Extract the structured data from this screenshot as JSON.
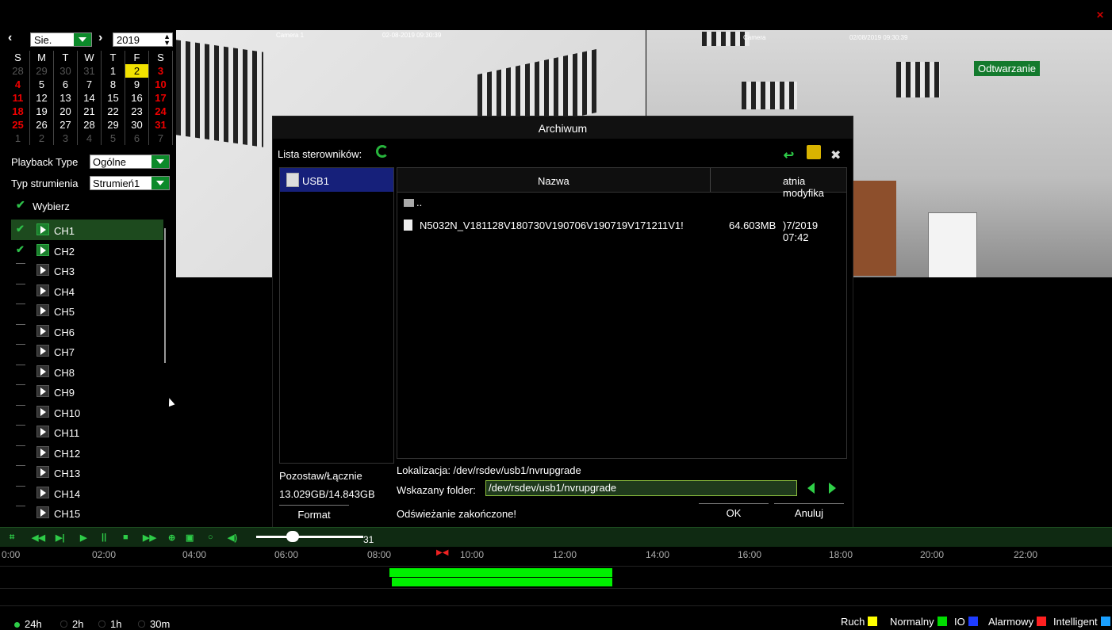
{
  "colors": {
    "accent_green": "#2ecc48",
    "selection_blue": "#16207a",
    "today_yellow": "#f2e200",
    "weekend_red": "#e00000"
  },
  "calendar": {
    "month": "Sie.",
    "year": "2019",
    "weekdays": [
      "S",
      "M",
      "T",
      "W",
      "T",
      "F",
      "S"
    ],
    "weeks": [
      [
        "28",
        "29",
        "30",
        "31",
        "1",
        "2",
        "3"
      ],
      [
        "4",
        "5",
        "6",
        "7",
        "8",
        "9",
        "10"
      ],
      [
        "11",
        "12",
        "13",
        "14",
        "15",
        "16",
        "17"
      ],
      [
        "18",
        "19",
        "20",
        "21",
        "22",
        "23",
        "24"
      ],
      [
        "25",
        "26",
        "27",
        "28",
        "29",
        "30",
        "31"
      ],
      [
        "1",
        "2",
        "3",
        "4",
        "5",
        "6",
        "7"
      ]
    ]
  },
  "left_panel": {
    "playback_type_label": "Playback Type",
    "playback_type_value": "Ogólne",
    "stream_type_label": "Typ strumienia",
    "stream_type_value": "Strumień1",
    "select_all_label": "Wybierz",
    "channels": [
      "CH1",
      "CH2",
      "CH3",
      "CH4",
      "CH5",
      "CH6",
      "CH7",
      "CH8",
      "CH9",
      "CH10",
      "CH11",
      "CH12",
      "CH13",
      "CH14",
      "CH15"
    ]
  },
  "video": {
    "cam1_label": "Camera 1",
    "cam1_time": "02-08-2019 09:30:39",
    "cam2_label": "Camera",
    "cam2_time": "02/08/2019 09:30:39",
    "playback_badge": "Odtwarzanie"
  },
  "dialog": {
    "title": "Archiwum",
    "drivers_label": "Lista sterowników:",
    "drive_name": "USB1",
    "col_name": "Nazwa",
    "col_modified": "atnia modyfika",
    "parent_dir": "..",
    "file_name": "N5032N_V181128V180730V190706V190719V171211V1!",
    "file_size": "64.603MB",
    "file_modified": ")7/2019 07:42",
    "remaining_label": "Pozostaw/Łącznie",
    "remaining_value": "13.029GB/14.843GB",
    "format_button": "Format",
    "location_text": "Lokalizacja: /dev/rsdev/usb1/nvrupgrade",
    "folder_label": "Wskazany folder:",
    "folder_value": "/dev/rsdev/usb1/nvrupgrade",
    "status": "Odświeżanie zakończone!",
    "ok_button": "OK",
    "cancel_button": "Anuluj"
  },
  "playback": {
    "volume_value": "31"
  },
  "timeline": {
    "ticks": [
      "0:00",
      "02:00",
      "04:00",
      "06:00",
      "08:00",
      "10:00",
      "12:00",
      "14:00",
      "16:00",
      "18:00",
      "20:00",
      "22:00"
    ],
    "records": [
      {
        "track": 1,
        "start_hour": 8.4,
        "end_hour": 13.2
      },
      {
        "track": 2,
        "start_hour": 8.45,
        "end_hour": 13.2
      }
    ]
  },
  "range_options": [
    "24h",
    "2h",
    "1h",
    "30m"
  ],
  "legend": [
    {
      "label": "Ruch",
      "color": "#ffff00"
    },
    {
      "label": "Normalny",
      "color": "#00dd00"
    },
    {
      "label": "IO",
      "color": "#1e3cff"
    },
    {
      "label": "Alarmowy",
      "color": "#ff2020"
    },
    {
      "label": "Intelligent",
      "color": "#1aa0ff"
    }
  ]
}
